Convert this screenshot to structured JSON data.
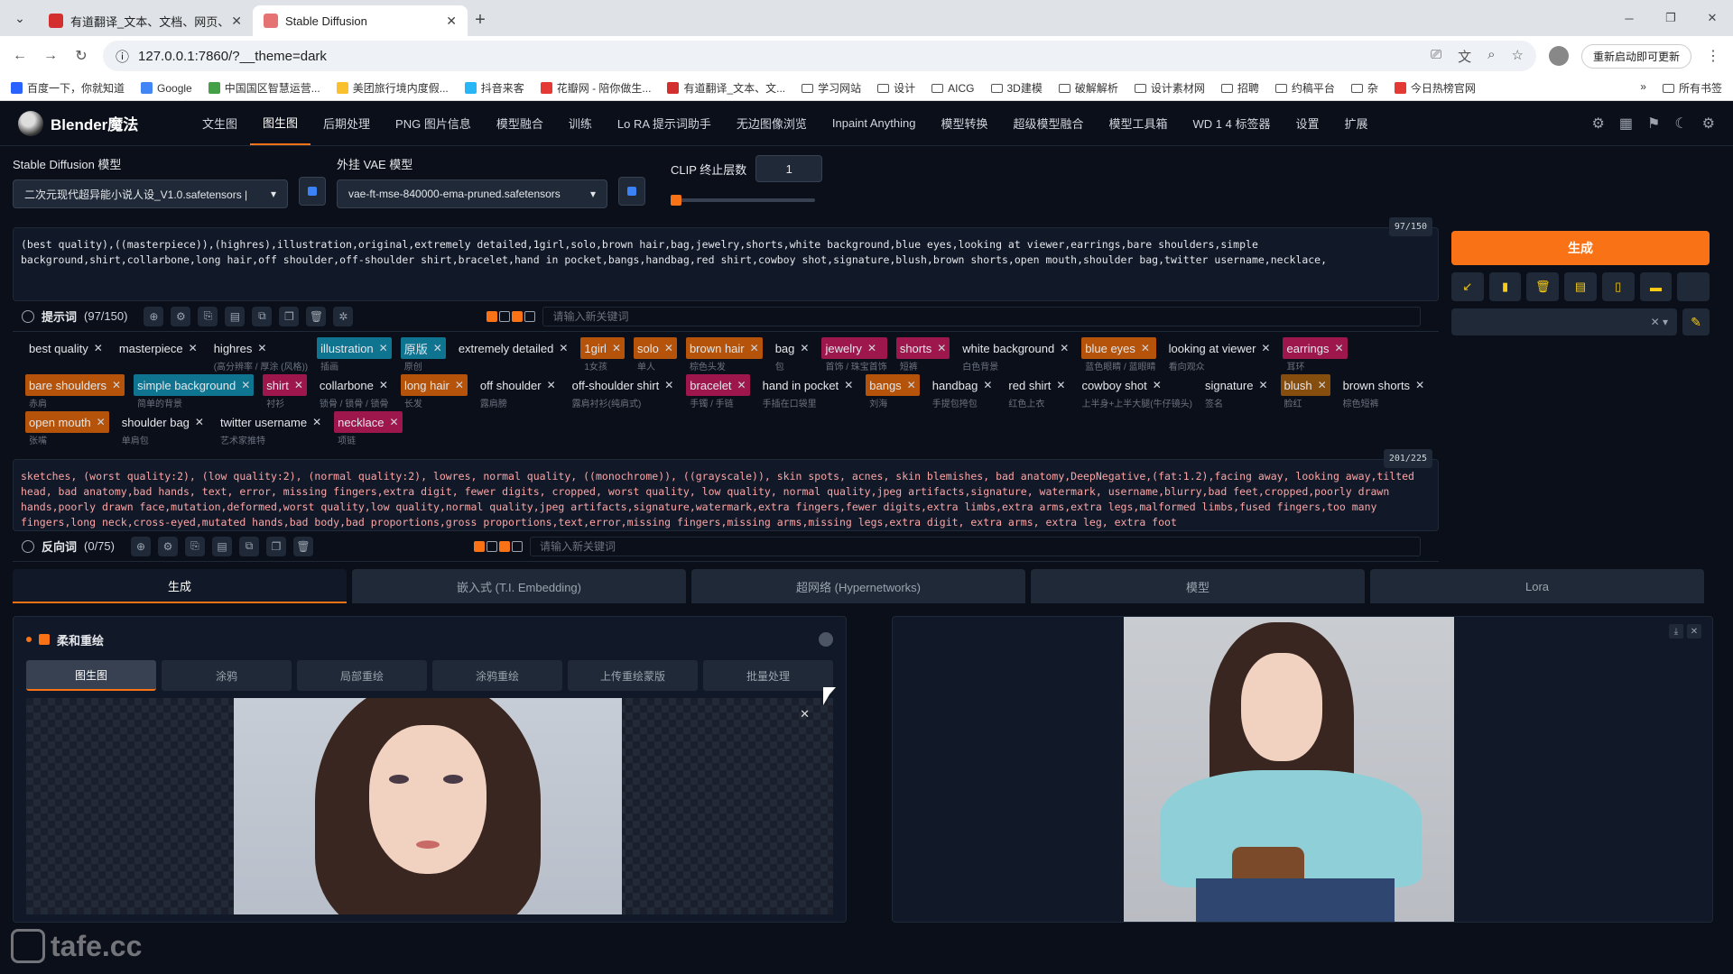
{
  "browser": {
    "tabs": [
      {
        "title": "有道翻译_文本、文档、网页、",
        "favcolor": "#d32f2f"
      },
      {
        "title": "Stable Diffusion",
        "favcolor": "#e57373"
      }
    ],
    "url": "127.0.0.1:7860/?__theme=dark",
    "restart_label": "重新启动即可更新",
    "bookmarks": [
      {
        "label": "百度一下，你就知道",
        "type": "site",
        "color": "#2962ff"
      },
      {
        "label": "Google",
        "type": "site",
        "color": "#4285f4"
      },
      {
        "label": "中国国区智慧运营...",
        "type": "site",
        "color": "#43a047"
      },
      {
        "label": "美团旅行境内度假...",
        "type": "site",
        "color": "#fbc02d"
      },
      {
        "label": "抖音来客",
        "type": "site",
        "color": "#29b6f6"
      },
      {
        "label": "花瓣网 - 陪你做生...",
        "type": "site",
        "color": "#e53935"
      },
      {
        "label": "有道翻译_文本、文...",
        "type": "site",
        "color": "#d32f2f"
      },
      {
        "label": "学习网站",
        "type": "folder"
      },
      {
        "label": "设计",
        "type": "folder"
      },
      {
        "label": "AICG",
        "type": "folder"
      },
      {
        "label": "3D建模",
        "type": "folder"
      },
      {
        "label": "破解解析",
        "type": "folder"
      },
      {
        "label": "设计素材网",
        "type": "folder"
      },
      {
        "label": "招聘",
        "type": "folder"
      },
      {
        "label": "约稿平台",
        "type": "folder"
      },
      {
        "label": "杂",
        "type": "folder"
      },
      {
        "label": "今日热榜官网",
        "type": "site",
        "color": "#e53935"
      }
    ],
    "all_bookmarks": "所有书签"
  },
  "app": {
    "brand": "Blender魔法",
    "nav": [
      "文生图",
      "图生图",
      "后期处理",
      "PNG 图片信息",
      "模型融合",
      "训练",
      "Lo RA 提示词助手",
      "无边图像浏览",
      "Inpaint Anything",
      "模型转换",
      "超级模型融合",
      "模型工具箱",
      "WD 1 4 标签器",
      "设置",
      "扩展"
    ],
    "active_nav": "图生图"
  },
  "models": {
    "sd_label": "Stable Diffusion 模型",
    "sd_value": "二次元现代超异能小说人设_V1.0.safetensors |",
    "vae_label": "外挂 VAE 模型",
    "vae_value": "vae-ft-mse-840000-ema-pruned.safetensors",
    "clip_label": "CLIP 终止层数",
    "clip_value": "1"
  },
  "prompt": {
    "counter": "97/150",
    "text": "(best quality),((masterpiece)),(highres),illustration,original,extremely detailed,1girl,solo,brown hair,bag,jewelry,shorts,white background,blue eyes,looking at viewer,earrings,bare shoulders,simple background,shirt,collarbone,long hair,off shoulder,off-shoulder shirt,bracelet,hand in pocket,bangs,handbag,red shirt,cowboy shot,signature,blush,brown shorts,open mouth,shoulder bag,twitter username,necklace,",
    "toolbar_label": "提示词",
    "toolbar_count": "(97/150)",
    "new_keyword_placeholder": "请输入新关键词",
    "tags": [
      {
        "en": "best quality",
        "zh": "",
        "color": ""
      },
      {
        "en": "masterpiece",
        "zh": "",
        "color": ""
      },
      {
        "en": "highres",
        "zh": "(高分辨率 / 厚涂 (风格))",
        "color": ""
      },
      {
        "en": "illustration",
        "zh": "插画",
        "color": "#0e7490"
      },
      {
        "en": "原版",
        "zh": "原创",
        "color": "#0e7490"
      },
      {
        "en": "extremely detailed",
        "zh": "",
        "color": ""
      },
      {
        "en": "1girl",
        "zh": "1女孩",
        "color": "#b45309"
      },
      {
        "en": "solo",
        "zh": "单人",
        "color": "#b45309"
      },
      {
        "en": "brown hair",
        "zh": "棕色头发",
        "color": "#b45309"
      },
      {
        "en": "bag",
        "zh": "包",
        "color": ""
      },
      {
        "en": "jewelry",
        "zh": "首饰 / 珠宝首饰",
        "color": "#9d174d"
      },
      {
        "en": "shorts",
        "zh": "短裤",
        "color": "#9d174d"
      },
      {
        "en": "white background",
        "zh": "白色背景",
        "color": ""
      },
      {
        "en": "blue eyes",
        "zh": "蓝色眼睛 / 蓝眼睛",
        "color": "#b45309"
      },
      {
        "en": "looking at viewer",
        "zh": "看向观众",
        "color": ""
      },
      {
        "en": "earrings",
        "zh": "耳环",
        "color": "#9d174d"
      },
      {
        "en": "bare shoulders",
        "zh": "赤肩",
        "color": "#b45309"
      },
      {
        "en": "simple background",
        "zh": "简单的背景",
        "color": "#0e7490"
      },
      {
        "en": "shirt",
        "zh": "衬衫",
        "color": "#9d174d"
      },
      {
        "en": "collarbone",
        "zh": "锁骨 / 锁骨 / 锁骨",
        "color": ""
      },
      {
        "en": "long hair",
        "zh": "长发",
        "color": "#b45309"
      },
      {
        "en": "off shoulder",
        "zh": "露肩膀",
        "color": ""
      },
      {
        "en": "off-shoulder shirt",
        "zh": "露肩衬衫(纯肩式)",
        "color": ""
      },
      {
        "en": "bracelet",
        "zh": "手镯 / 手链",
        "color": "#9d174d"
      },
      {
        "en": "hand in pocket",
        "zh": "手插在口袋里",
        "color": ""
      },
      {
        "en": "bangs",
        "zh": "刘海",
        "color": "#b45309"
      },
      {
        "en": "handbag",
        "zh": "手提包挎包",
        "color": ""
      },
      {
        "en": "red shirt",
        "zh": "红色上衣",
        "color": ""
      },
      {
        "en": "cowboy shot",
        "zh": "上半身+上半大腿(牛仔镜头)",
        "color": ""
      },
      {
        "en": "signature",
        "zh": "签名",
        "color": ""
      },
      {
        "en": "blush",
        "zh": "脸红",
        "color": "#854d0e"
      },
      {
        "en": "brown shorts",
        "zh": "棕色短裤",
        "color": ""
      },
      {
        "en": "open mouth",
        "zh": "张嘴",
        "color": "#b45309"
      },
      {
        "en": "shoulder bag",
        "zh": "单肩包",
        "color": ""
      },
      {
        "en": "twitter username",
        "zh": "艺术家推特",
        "color": ""
      },
      {
        "en": "necklace",
        "zh": "项链",
        "color": "#9d174d"
      }
    ]
  },
  "negative": {
    "counter": "201/225",
    "text": "sketches, (worst quality:2), (low quality:2), (normal quality:2), lowres, normal quality, ((monochrome)), ((grayscale)), skin spots, acnes, skin blemishes, bad anatomy,DeepNegative,(fat:1.2),facing away, looking away,tilted head, bad anatomy,bad hands, text, error, missing fingers,extra digit, fewer digits, cropped, worst quality, low quality, normal quality,jpeg artifacts,signature, watermark, username,blurry,bad feet,cropped,poorly drawn hands,poorly drawn face,mutation,deformed,worst quality,low quality,normal quality,jpeg artifacts,signature,watermark,extra fingers,fewer digits,extra limbs,extra arms,extra legs,malformed limbs,fused fingers,too many fingers,long neck,cross-eyed,mutated hands,bad body,bad proportions,gross proportions,text,error,missing fingers,missing arms,missing legs,extra digit, extra arms, extra leg, extra foot",
    "toolbar_label": "反向词",
    "toolbar_count": "(0/75)",
    "new_keyword_placeholder": "请输入新关键词"
  },
  "generate": {
    "label": "生成"
  },
  "bottom_tabs": [
    "生成",
    "嵌入式 (T.I. Embedding)",
    "超网络 (Hypernetworks)",
    "模型",
    "Lora"
  ],
  "img2img": {
    "accordion": "柔和重绘",
    "subtabs": [
      "图生图",
      "涂鸦",
      "局部重绘",
      "涂鸦重绘",
      "上传重绘蒙版",
      "批量处理"
    ]
  },
  "watermark": "tafe.cc"
}
